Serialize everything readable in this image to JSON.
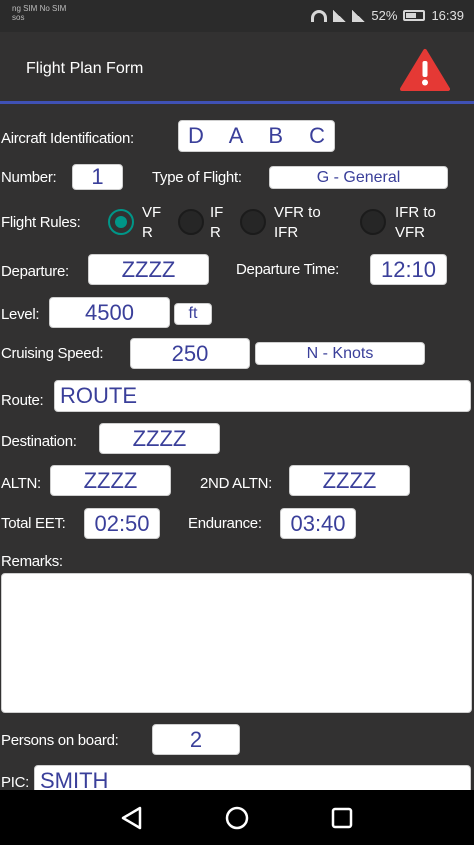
{
  "status": {
    "carrier": "ng SIM No SIM\nsos",
    "battery": "52%",
    "time": "16:39"
  },
  "app": {
    "title": "Flight Plan Form",
    "alert_icon": "warning-triangle-icon",
    "accent_color": "#3f51b5",
    "alert_color": "#e53935"
  },
  "form": {
    "aircraft_id": {
      "label": "Aircraft Identification:",
      "value": "D A B C"
    },
    "number": {
      "label": "Number:",
      "value": "1"
    },
    "type_of_flight": {
      "label": "Type of Flight:",
      "value": "G - General"
    },
    "flight_rules": {
      "label": "Flight Rules:",
      "options": [
        "VF\nR",
        "IF\nR",
        "VFR to\nIFR",
        "IFR to\nVFR"
      ],
      "selected": 0,
      "selected_color": "#009688"
    },
    "departure": {
      "label": "Departure:",
      "value": "ZZZZ"
    },
    "departure_time": {
      "label": "Departure Time:",
      "value": "12:10"
    },
    "level": {
      "label": "Level:",
      "value": "4500",
      "unit": "ft"
    },
    "cruising_speed": {
      "label": "Cruising Speed:",
      "value": "250",
      "unit": "N - Knots"
    },
    "route": {
      "label": "Route:",
      "value": "ROUTE"
    },
    "destination": {
      "label": "Destination:",
      "value": "ZZZZ"
    },
    "altn": {
      "label": "ALTN:",
      "value": "ZZZZ"
    },
    "altn2": {
      "label": "2ND ALTN:",
      "value": "ZZZZ"
    },
    "total_eet": {
      "label": "Total EET:",
      "value": "02:50"
    },
    "endurance": {
      "label": "Endurance:",
      "value": "03:40"
    },
    "remarks": {
      "label": "Remarks:",
      "value": ""
    },
    "persons": {
      "label": "Persons on board:",
      "value": "2"
    },
    "pic": {
      "label": "PIC:",
      "value": "SMITH"
    }
  }
}
